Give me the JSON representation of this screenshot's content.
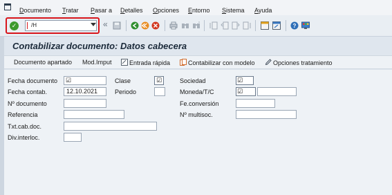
{
  "menu": {
    "items": [
      {
        "label": "Documento",
        "underline": "D",
        "rest": "ocumento"
      },
      {
        "label": "Tratar",
        "underline": "T",
        "rest": "ratar"
      },
      {
        "label": "Pasar a",
        "underline": "P",
        "rest": "asar a"
      },
      {
        "label": "Detalles",
        "underline": "D",
        "rest": "etalles"
      },
      {
        "label": "Opciones",
        "underline": "O",
        "rest": "pciones"
      },
      {
        "label": "Entorno",
        "underline": "E",
        "rest": "ntorno"
      },
      {
        "label": "Sistema",
        "underline": "S",
        "rest": "istema"
      },
      {
        "label": "Ayuda",
        "underline": "A",
        "rest": "yuda"
      }
    ]
  },
  "toolbar": {
    "command_value": "/H",
    "nav_back_glyph": "«",
    "icons": [
      "save-icon",
      "back-icon",
      "exit-icon",
      "cancel-icon",
      "print-icon",
      "find-icon",
      "find-next-icon",
      "first-page-icon",
      "previous-page-icon",
      "next-page-icon",
      "last-page-icon",
      "create-session-icon",
      "shortcut-icon",
      "help-icon",
      "layout-icon"
    ]
  },
  "title": "Contabilizar documento: Datos cabecera",
  "app_toolbar": {
    "hold_document": "Documento apartado",
    "acct_model": "Mod.Imput",
    "fast_entry": "Entrada rápida",
    "post_with_ref": "Contabilizar con modelo",
    "editing_options": "Opciones tratamiento"
  },
  "form": {
    "doc_date_label": "Fecha documento",
    "doc_date_value": "",
    "posting_date_label": "Fecha contab.",
    "posting_date_value": "12.10.2021",
    "doc_number_label": "Nº documento",
    "reference_label": "Referencia",
    "header_text_label": "Txt.cab.doc.",
    "trading_partner_label": "Div.interloc.",
    "type_label": "Clase",
    "period_label": "Periodo",
    "company_label": "Sociedad",
    "currency_label": "Moneda/T/C",
    "translation_date_label": "Fe.conversión",
    "cross_cc_label": "Nº multisoc.",
    "required_mark": "☑"
  }
}
